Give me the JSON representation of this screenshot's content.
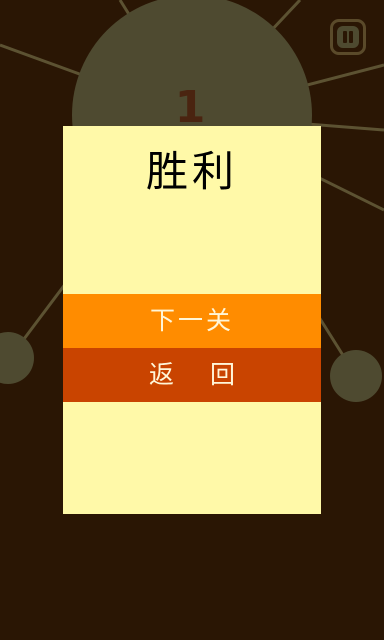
{
  "level": {
    "number": "1"
  },
  "dialog": {
    "title": "胜利",
    "next_label": "下一关",
    "back_label": "返回"
  },
  "colors": {
    "background": "#2a1604",
    "wheel": "#4e4a30",
    "spokes": "#5c5232",
    "dialog_bg": "#fff9a8",
    "next_button": "#ff8c00",
    "back_button": "#c94400"
  },
  "icons": {
    "pause": "pause-icon"
  }
}
